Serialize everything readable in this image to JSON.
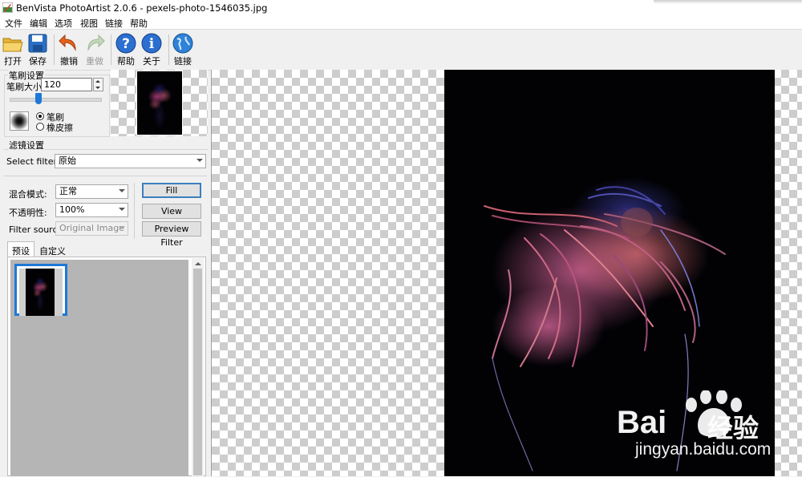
{
  "window": {
    "title": "BenVista PhotoArtist 2.0.6 - pexels-photo-1546035.jpg"
  },
  "menu": [
    "文件",
    "编辑",
    "选项",
    "视图",
    "链接",
    "帮助"
  ],
  "toolbar": {
    "open": "打开",
    "save": "保存",
    "undo": "撤销",
    "redo": "重做",
    "help": "帮助",
    "about": "关于",
    "link": "链接"
  },
  "brush": {
    "group_title": "笔刷设置",
    "size_label": "笔刷大小:",
    "size_value": "120",
    "mode_brush": "笔刷",
    "mode_eraser": "橡皮擦",
    "selected_mode": "brush"
  },
  "filter": {
    "group_title": "滤镜设置",
    "select_label": "Select filter:",
    "select_value": "原始",
    "blend_label": "混合模式:",
    "blend_value": "正常",
    "opacity_label": "不透明性:",
    "opacity_value": "100%",
    "source_label": "Filter source:",
    "source_value": "Original Image",
    "fill_button": "Fill",
    "view_original_button": "View Original",
    "preview_filter_button": "Preview Filter"
  },
  "presets": {
    "tabs": [
      "预设",
      "自定义"
    ],
    "active_tab": "预设"
  },
  "watermark": {
    "brand": "Bai",
    "brand_cn": "经验",
    "url": "jingyan.baidu.com"
  },
  "colors": {
    "accent": "#1e78d7",
    "canvas_photo_bg": "#020205",
    "checker_dark": "#cdcdcd",
    "checker_light": "#ffffff"
  }
}
